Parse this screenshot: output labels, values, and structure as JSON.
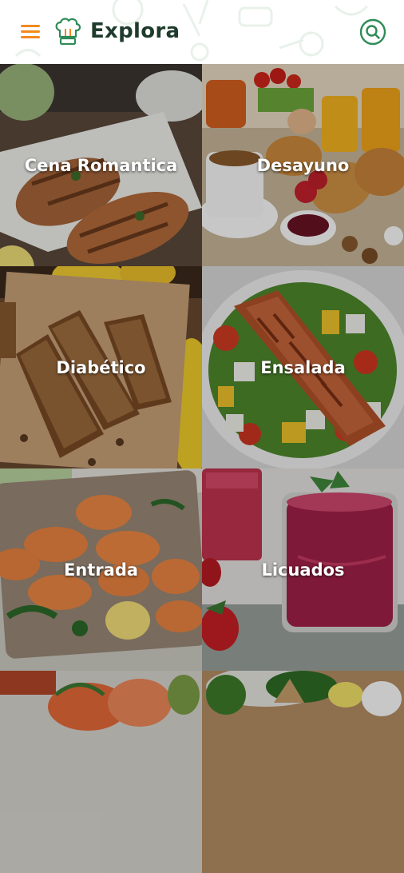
{
  "header": {
    "title": "Explora",
    "menu_icon": "hamburger-menu-icon",
    "logo_icon": "chef-hat-logo-icon",
    "search_icon": "search-icon"
  },
  "colors": {
    "accent_orange": "#f28a1e",
    "accent_green": "#2e8b57",
    "title_dark": "#1f3b2c"
  },
  "categories": [
    {
      "label": "Cena Romantica"
    },
    {
      "label": "Desayuno"
    },
    {
      "label": "Diabético"
    },
    {
      "label": "Ensalada"
    },
    {
      "label": "Entrada"
    },
    {
      "label": "Licuados"
    },
    {
      "label": ""
    },
    {
      "label": ""
    }
  ]
}
